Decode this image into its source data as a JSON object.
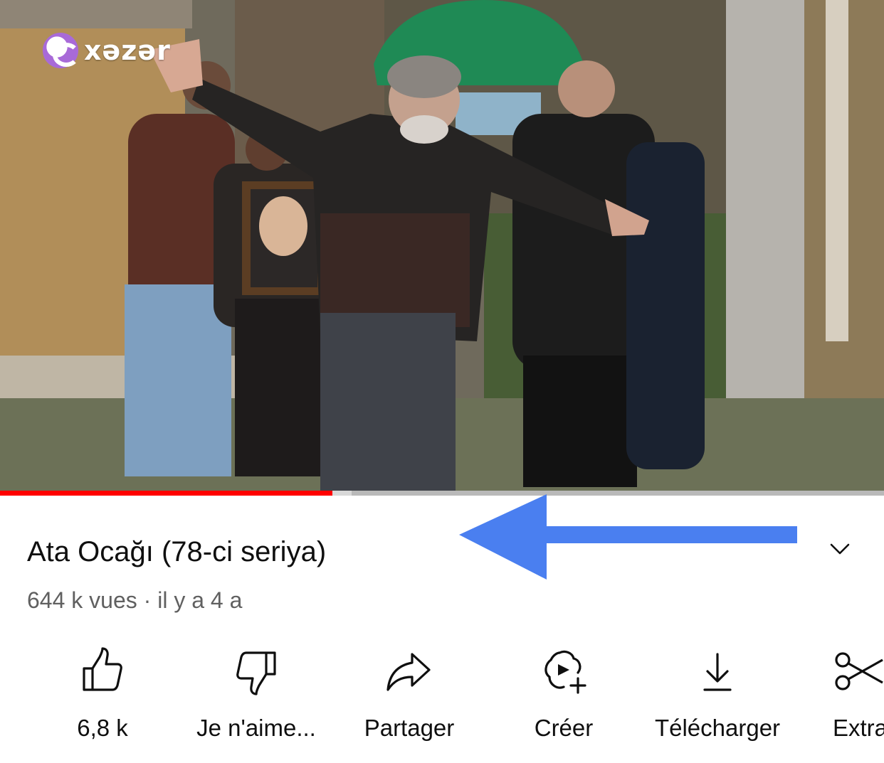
{
  "video": {
    "channel_watermark": "xəzər",
    "progress_played": 0.376,
    "progress_buffered": 0.398
  },
  "title": "Ata Ocağı (78-ci seriya)",
  "meta": "644 k vues · il y a 4 a",
  "annotation": {
    "arrow_color": "#4a7ff0"
  },
  "actions": {
    "like_count": "6,8 k",
    "dislike_label": "Je n'aime...",
    "share_label": "Partager",
    "create_label": "Créer",
    "download_label": "Télécharger",
    "extra_label": "Extra"
  },
  "icons": {
    "like": "thumbs-up-icon",
    "dislike": "thumbs-down-icon",
    "share": "share-arrow-icon",
    "create": "create-remix-icon",
    "download": "download-icon",
    "extra": "scissors-icon",
    "expand": "chevron-down-icon"
  },
  "colors": {
    "progress_played": "#ff0000",
    "text_primary": "#0f0f0f",
    "text_secondary": "#606060"
  }
}
